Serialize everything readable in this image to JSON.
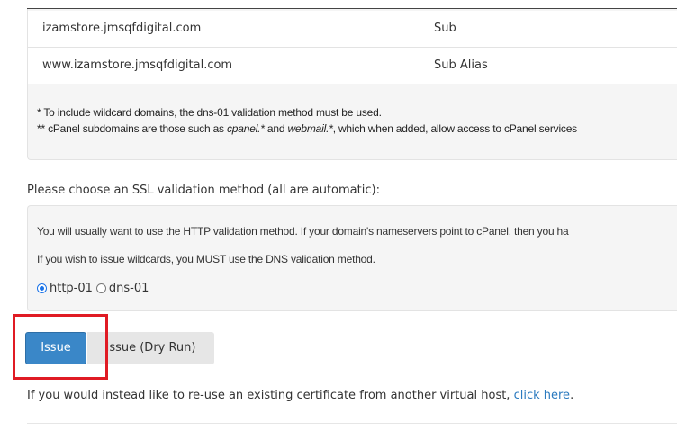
{
  "domains_table": {
    "rows": [
      {
        "domain": "izamstore.jmsqfdigital.com",
        "type": "Sub"
      },
      {
        "domain": "www.izamstore.jmsqfdigital.com",
        "type": "Sub Alias"
      }
    ]
  },
  "notes": {
    "wildcard": "* To include wildcard domains, the dns-01 validation method must be used.",
    "subdomains_prefix": "** cPanel subdomains are those such as ",
    "subdomains_cpanel": "cpanel.*",
    "subdomains_and": " and ",
    "subdomains_webmail": "webmail.*",
    "subdomains_suffix": ", which when added, allow access to cPanel services"
  },
  "validation": {
    "heading": "Please choose an SSL validation method (all are automatic):",
    "info_http": "You will usually want to use the HTTP validation method. If your domain's nameservers point to cPanel, then you ha",
    "info_wildcard": "If you wish to issue wildcards, you MUST use the DNS validation method.",
    "options": [
      {
        "label": "http-01",
        "checked": true
      },
      {
        "label": "dns-01",
        "checked": false
      }
    ]
  },
  "buttons": {
    "issue": "Issue",
    "dry_run": "Issue (Dry Run)"
  },
  "reuse": {
    "text": "If you would instead like to re-use an existing certificate from another virtual host, ",
    "link": "click here",
    "end": "."
  },
  "colors": {
    "primary": "#3a87c8",
    "highlight": "#e01b24",
    "link": "#2a7abf"
  }
}
